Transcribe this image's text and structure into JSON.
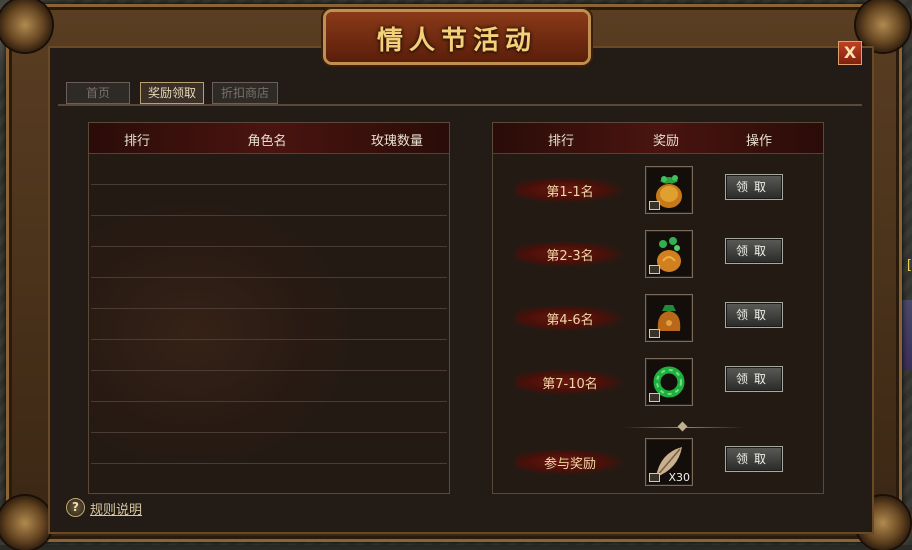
{
  "window": {
    "title": "情人节活动",
    "close_label": "X",
    "tabs": [
      {
        "label": "首页",
        "active": false
      },
      {
        "label": "奖励领取",
        "active": true
      },
      {
        "label": "折扣商店",
        "active": false
      }
    ]
  },
  "leaderboard": {
    "headers": [
      "排行",
      "角色名",
      "玫瑰数量"
    ],
    "rows": []
  },
  "rewards": {
    "headers": [
      "排行",
      "奖励",
      "操作"
    ],
    "items": [
      {
        "rank": "第1-1名",
        "icon": "orange-green-pouch-icon",
        "claim_label": "领取"
      },
      {
        "rank": "第2-3名",
        "icon": "orange-jade-pouch-icon",
        "claim_label": "领取"
      },
      {
        "rank": "第4-6名",
        "icon": "brown-pouch-icon",
        "claim_label": "领取"
      },
      {
        "rank": "第7-10名",
        "icon": "jade-ring-icon",
        "claim_label": "领取"
      },
      {
        "rank": "参与奖励",
        "icon": "feather-icon",
        "count": "X30",
        "claim_label": "领取"
      }
    ]
  },
  "footer": {
    "help_label": "规则说明",
    "help_icon": "?"
  },
  "colors": {
    "title_gold": "#f4d07a",
    "header_red": "#4a1410",
    "frame_bronze": "#8a6434"
  }
}
